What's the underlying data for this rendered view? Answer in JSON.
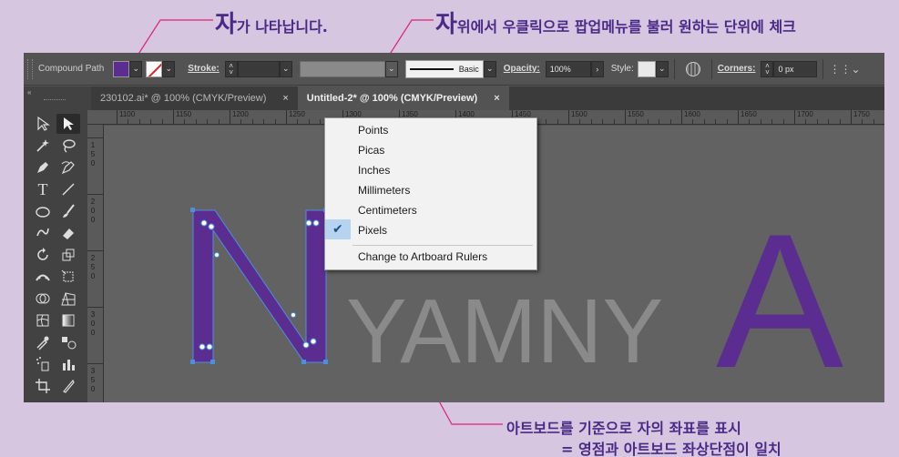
{
  "annotations": {
    "top_left": {
      "big": "자",
      "rest": "가 나타납니다."
    },
    "top_right": {
      "big": "자",
      "rest": "위에서 우클릭으로 팝업메뉴를 불러 원하는 단위에 체크"
    },
    "bottom_line1": "아트보드를 기준으로 자의 좌표를 표시",
    "bottom_line2": "= 영점과 아트보드 좌상단점이 일치"
  },
  "control_bar": {
    "object_type": "Compound Path",
    "stroke_label": "Stroke:",
    "brush_label": "Basic",
    "opacity_label": "Opacity:",
    "opacity_value": "100%",
    "style_label": "Style:",
    "corners_label": "Corners:",
    "corners_value": "0 px",
    "fill_color": "#5b2d91"
  },
  "tabs": [
    {
      "label": "230102.ai* @ 100% (CMYK/Preview)",
      "close": "×"
    },
    {
      "label": "Untitled-2* @ 100% (CMYK/Preview)",
      "close": "×"
    }
  ],
  "ruler_h": [
    "1100",
    "1150",
    "1200",
    "1250",
    "1300",
    "1350",
    "1400",
    "1450",
    "1500",
    "1550",
    "1600",
    "1650",
    "1700",
    "1750"
  ],
  "ruler_v": [
    {
      "digits": [
        "1",
        "5",
        "0"
      ]
    },
    {
      "digits": [
        "2",
        "0",
        "0"
      ]
    },
    {
      "digits": [
        "2",
        "5",
        "0"
      ]
    },
    {
      "digits": [
        "3",
        "0",
        "0"
      ]
    },
    {
      "digits": [
        "3",
        "5",
        "0"
      ]
    }
  ],
  "context_menu": {
    "items": [
      "Points",
      "Picas",
      "Inches",
      "Millimeters",
      "Centimeters",
      "Pixels"
    ],
    "checked": "Pixels",
    "extra": "Change to Artboard Rulers"
  },
  "artwork": {
    "letter_n": "N",
    "middle_text": "YAMNY",
    "letter_a": "A",
    "purple": "#5b2d91",
    "grey": "#8a8a8a"
  }
}
